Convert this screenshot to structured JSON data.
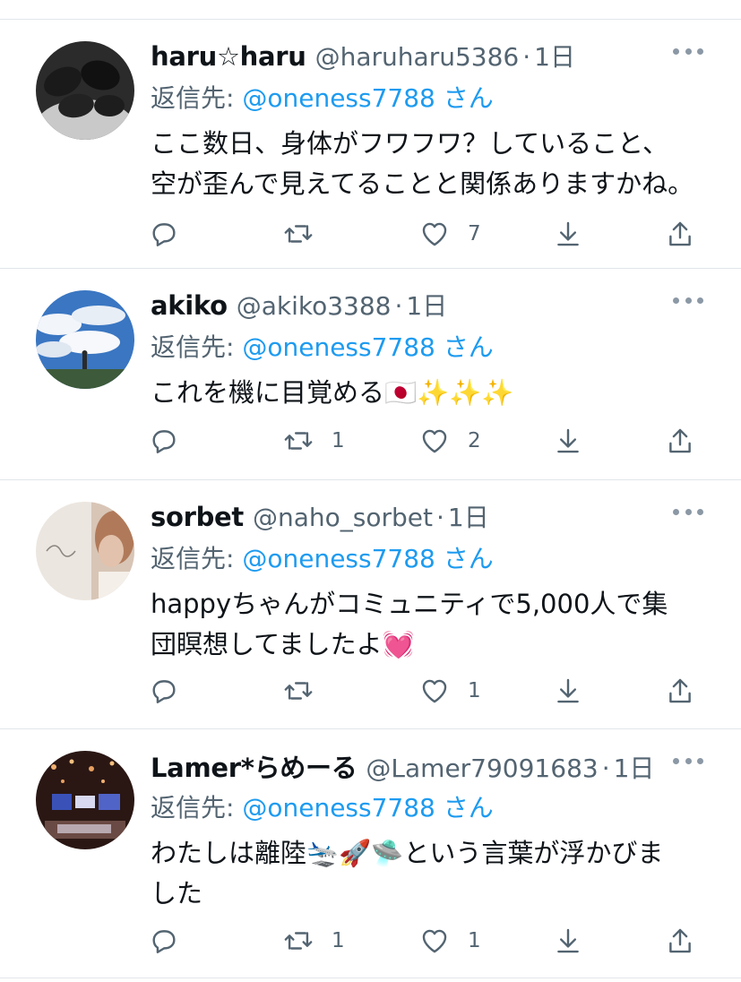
{
  "colors": {
    "accent": "#1d9bf0",
    "muted": "#536471",
    "text": "#0f1419",
    "divider": "#e1e6ea"
  },
  "tweets": [
    {
      "name": "haru☆haru",
      "handle": "@haruharu5386",
      "dot": "·",
      "time": "1日",
      "reply_prefix": "返信先: ",
      "reply_mention": "@oneness7788",
      "reply_suffix": " さん",
      "text": "ここ数日、身体がフワフワ？していること、\n空が歪んで見えてることと関係ありますかね。",
      "replies": "",
      "retweets": "",
      "likes": "7"
    },
    {
      "name": "akiko",
      "handle": "@akiko3388",
      "dot": "·",
      "time": "1日",
      "reply_prefix": "返信先: ",
      "reply_mention": "@oneness7788",
      "reply_suffix": " さん",
      "text": "これを機に目覚める🇯🇵✨✨✨",
      "replies": "",
      "retweets": "1",
      "likes": "2"
    },
    {
      "name": "sorbet",
      "handle": "@naho_sorbet",
      "dot": "·",
      "time": "1日",
      "reply_prefix": "返信先: ",
      "reply_mention": "@oneness7788",
      "reply_suffix": " さん",
      "text": "happyちゃんがコミュニティで5,000人で集\n団瞑想してましたよ💓",
      "replies": "",
      "retweets": "",
      "likes": "1"
    },
    {
      "name": "Lamer*らめーる",
      "handle": "@Lamer79091683",
      "dot": "·",
      "time": "1日",
      "reply_prefix": "返信先: ",
      "reply_mention": "@oneness7788",
      "reply_suffix": " さん",
      "text": "わたしは離陸🛬🚀🛸という言葉が浮かびま\nした",
      "replies": "",
      "retweets": "1",
      "likes": "1"
    }
  ]
}
